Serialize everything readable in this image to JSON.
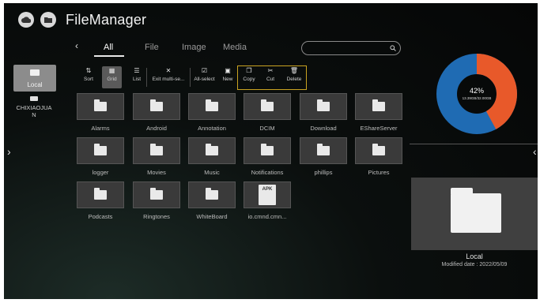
{
  "header": {
    "title": "FileManager"
  },
  "tabs": [
    {
      "label": "All",
      "active": true
    },
    {
      "label": "File",
      "active": false
    },
    {
      "label": "Image",
      "active": false
    },
    {
      "label": "Media",
      "active": false
    }
  ],
  "search": {
    "placeholder": "",
    "icon": "search-icon"
  },
  "sidebar": {
    "local_label": "Local",
    "device_label": "CHIXIAOJUAN"
  },
  "toolbar": {
    "sort": "Sort",
    "grid": "Grid",
    "list": "List",
    "exit_multi": "Exit multi-se...",
    "all_select": "All-select",
    "new": "New",
    "copy": "Copy",
    "cut": "Cut",
    "delete": "Delete"
  },
  "files": [
    {
      "name": "Alarms",
      "type": "folder"
    },
    {
      "name": "Android",
      "type": "folder"
    },
    {
      "name": "Annotation",
      "type": "folder"
    },
    {
      "name": "DCIM",
      "type": "folder"
    },
    {
      "name": "Download",
      "type": "folder"
    },
    {
      "name": "EShareServer",
      "type": "folder"
    },
    {
      "name": "logger",
      "type": "folder"
    },
    {
      "name": "Movies",
      "type": "folder"
    },
    {
      "name": "Music",
      "type": "folder"
    },
    {
      "name": "Notifications",
      "type": "folder"
    },
    {
      "name": "phillips",
      "type": "folder"
    },
    {
      "name": "Pictures",
      "type": "folder"
    },
    {
      "name": "Podcasts",
      "type": "folder"
    },
    {
      "name": "Ringtones",
      "type": "folder"
    },
    {
      "name": "WhiteBoard",
      "type": "folder"
    },
    {
      "name": "io.cmnd.cmn...",
      "type": "apk",
      "badge": "APK"
    }
  ],
  "storage": {
    "percent_text": "42%",
    "used_fraction": 0.42,
    "detail": "13.39GB/32.00GB",
    "used_color": "#e8592a",
    "free_color": "#1f6bb3"
  },
  "preview": {
    "name": "Local",
    "modified": "Modified date : 2022/05/09"
  }
}
